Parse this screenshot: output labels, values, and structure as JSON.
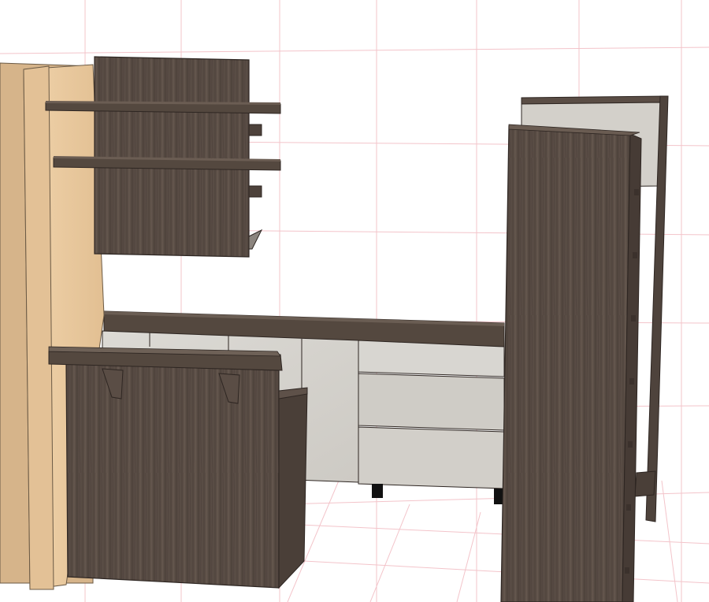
{
  "scene": {
    "view": "3d-furniture-render",
    "materials": {
      "dark_wood": "#5a4d45",
      "dark_wood_edge": "#3a302b",
      "light_wood": "#e9c9a0",
      "light_wood_side": "#d8b78d",
      "concrete": "#d6d4cf",
      "concrete_dark": "#c4c1bb",
      "grid_line": "#f2c0c6",
      "floor_line": "#efb0b8",
      "background": "#ffffff"
    },
    "objects": [
      "floor-grid",
      "light-wood-tall-panel",
      "dark-wall-cabinet",
      "upper-shelf",
      "lower-shelf",
      "back-countertop",
      "concrete-base-cabinets",
      "concrete-drawer-stack",
      "dark-peninsula-cabinet",
      "peninsula-countertop",
      "shelf-brackets",
      "tall-dark-column",
      "rear-tall-cabinet",
      "cabinet-feet"
    ]
  }
}
